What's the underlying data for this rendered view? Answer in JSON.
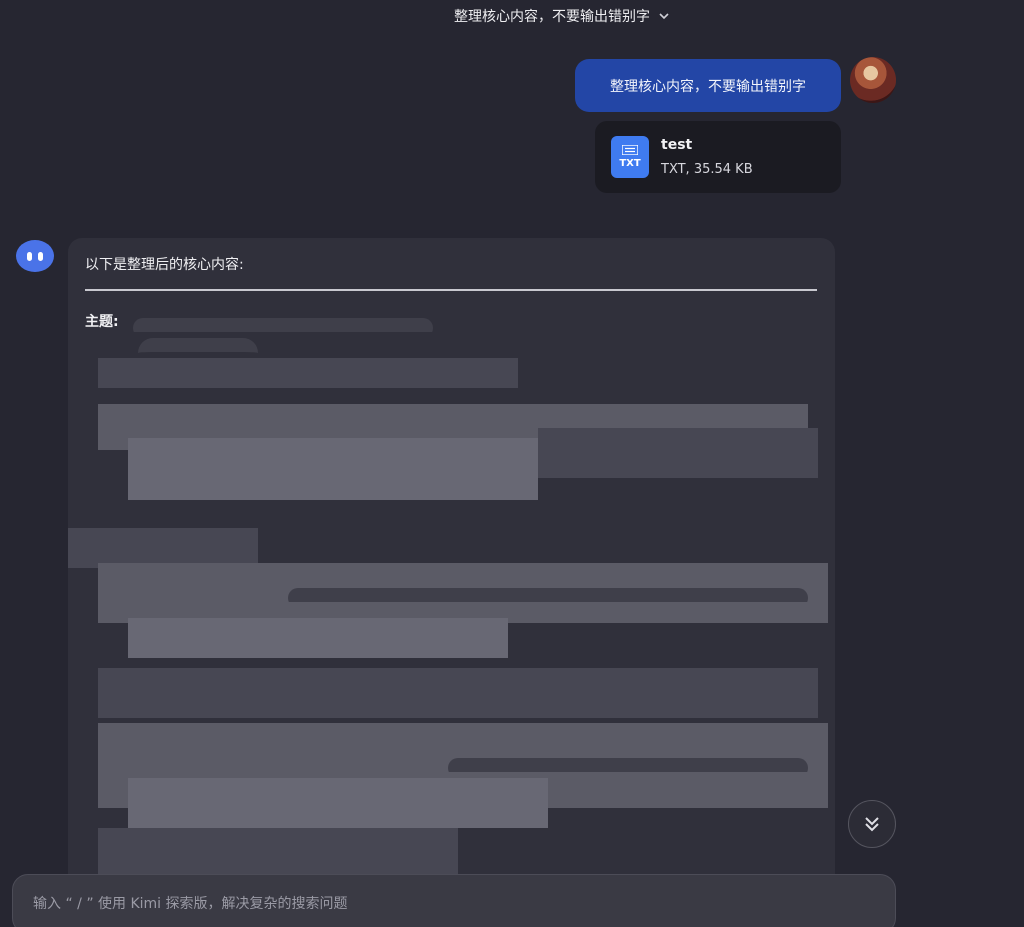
{
  "header": {
    "title": "整理核心内容，不要输出错别字",
    "dropdown_icon": "chevron-down-icon"
  },
  "user_message": {
    "text": "整理核心内容，不要输出错别字",
    "avatar": "user-avatar"
  },
  "attachment": {
    "name": "test",
    "meta": "TXT, 35.54 KB",
    "ext_label": "TXT",
    "icon": "txt-file-icon"
  },
  "assistant_message": {
    "intro": "以下是整理后的核心内容:",
    "topic_label": "主题:",
    "redacted": true
  },
  "controls": {
    "scroll_to_bottom_icon": "double-chevron-down-icon"
  },
  "composer": {
    "placeholder": "输入 “ / ” 使用 Kimi 探索版，解决复杂的搜索问题"
  },
  "colors": {
    "background": "#262631",
    "user_bubble": "#2346a6",
    "answer_card": "#30303b",
    "accent": "#4a73e8"
  }
}
